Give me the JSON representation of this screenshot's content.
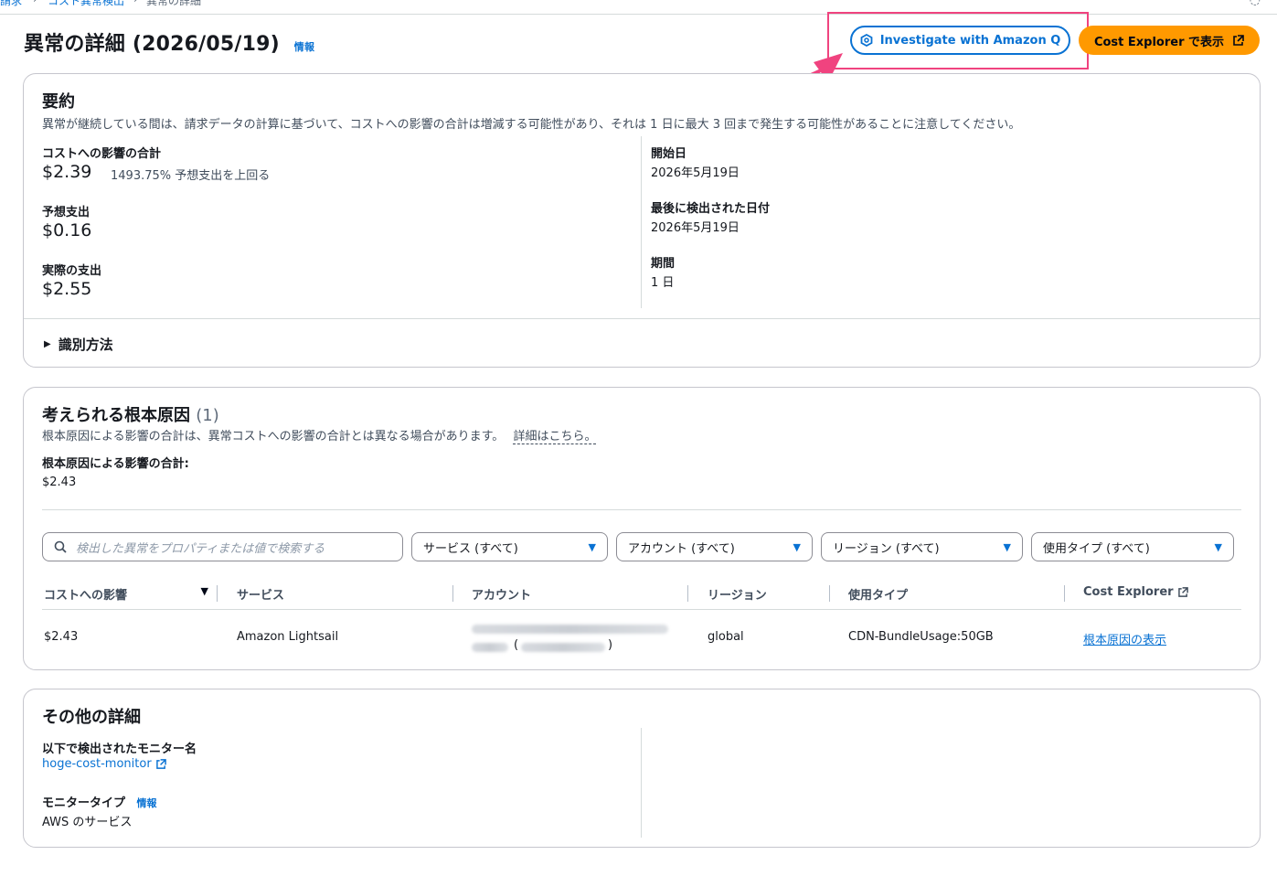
{
  "breadcrumb": {
    "b1": "請求",
    "b2": "コスト異常検出",
    "b3": "異常の詳細",
    "sep": "›"
  },
  "header": {
    "title": "異常の詳細 (2026/05/19)",
    "info": "情報",
    "btn_q": "Investigate with Amazon Q",
    "btn_ce": "Cost Explorer で表示"
  },
  "summary": {
    "heading": "要約",
    "note": "異常が継続している間は、請求データの計算に基づいて、コストへの影響の合計は増減する可能性があり、それは 1 日に最大 3 回まで発生する可能性があることに注意してください。",
    "impact_label": "コストへの影響の合計",
    "impact_value": "$2.39",
    "impact_pct": "1493.75% 予想支出を上回る",
    "expected_label": "予想支出",
    "expected_value": "$0.16",
    "actual_label": "実際の支出",
    "actual_value": "$2.55",
    "start_label": "開始日",
    "start_value": "2026年5月19日",
    "last_label": "最後に検出された日付",
    "last_value": "2026年5月19日",
    "period_label": "期間",
    "period_value": "1 日",
    "method": "識別方法"
  },
  "rootcause": {
    "heading": "考えられる根本原因",
    "count": "(1)",
    "note": "根本原因による影響の合計は、異常コストへの影響の合計とは異なる場合があります。",
    "more_link": "詳細はこちら。",
    "total_label": "根本原因による影響の合計:",
    "total_value": "$2.43",
    "search_placeholder": "検出した異常をプロパティまたは値で検索する",
    "filters": [
      "サービス (すべて)",
      "アカウント (すべて)",
      "リージョン (すべて)",
      "使用タイプ (すべて)"
    ],
    "columns": [
      "コストへの影響",
      "サービス",
      "アカウント",
      "リージョン",
      "使用タイプ",
      "Cost Explorer"
    ],
    "row": {
      "impact": "$2.43",
      "service": "Amazon Lightsail",
      "account_paren_open": "(",
      "account_paren_close": ")",
      "region": "global",
      "usage": "CDN-BundleUsage:50GB",
      "link": "根本原因の表示"
    }
  },
  "other": {
    "heading": "その他の詳細",
    "monitor_label": "以下で検出されたモニター名",
    "monitor_value": "hoge-cost-monitor",
    "type_label": "モニタータイプ",
    "type_info": "情報",
    "type_value": "AWS のサービス"
  }
}
